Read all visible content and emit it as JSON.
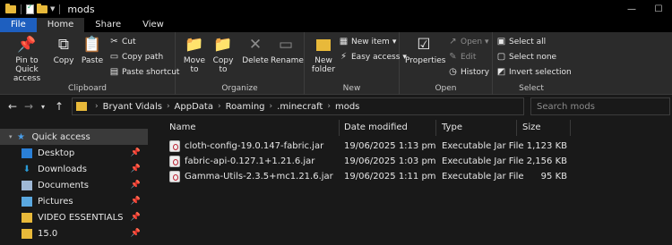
{
  "window": {
    "title": "mods"
  },
  "tabs": [
    "File",
    "Home",
    "Share",
    "View"
  ],
  "ribbon": {
    "clipboard": {
      "label": "Clipboard",
      "pin": "Pin to Quick access",
      "copy": "Copy",
      "paste": "Paste",
      "cut": "Cut",
      "copy_path": "Copy path",
      "paste_shortcut": "Paste shortcut"
    },
    "organize": {
      "label": "Organize",
      "move_to": "Move to",
      "copy_to": "Copy to",
      "delete": "Delete",
      "rename": "Rename"
    },
    "new": {
      "label": "New",
      "new_folder": "New folder",
      "new_item": "New item",
      "easy_access": "Easy access"
    },
    "open": {
      "label": "Open",
      "properties": "Properties",
      "open": "Open",
      "edit": "Edit",
      "history": "History"
    },
    "select": {
      "label": "Select",
      "select_all": "Select all",
      "select_none": "Select none",
      "invert": "Invert selection"
    }
  },
  "address": {
    "path": [
      "Bryant Vidals",
      "AppData",
      "Roaming",
      ".minecraft",
      "mods"
    ]
  },
  "search": {
    "placeholder": "Search mods"
  },
  "nav": [
    {
      "label": "Quick access",
      "icon": "star-icon",
      "pinned": false
    },
    {
      "label": "Desktop",
      "icon": "desktop-icon",
      "pinned": true
    },
    {
      "label": "Downloads",
      "icon": "download-icon",
      "pinned": true
    },
    {
      "label": "Documents",
      "icon": "documents-icon",
      "pinned": true
    },
    {
      "label": "Pictures",
      "icon": "pictures-icon",
      "pinned": true
    },
    {
      "label": "VIDEO ESSENTIALS",
      "icon": "folder-icon",
      "pinned": true
    },
    {
      "label": "15.0",
      "icon": "folder-icon",
      "pinned": true
    }
  ],
  "columns": {
    "name": "Name",
    "date": "Date modified",
    "type": "Type",
    "size": "Size"
  },
  "files": [
    {
      "name": "cloth-config-19.0.147-fabric.jar",
      "date": "19/06/2025 1:13 pm",
      "type": "Executable Jar File",
      "size": "1,123 KB"
    },
    {
      "name": "fabric-api-0.127.1+1.21.6.jar",
      "date": "19/06/2025 1:03 pm",
      "type": "Executable Jar File",
      "size": "2,156 KB"
    },
    {
      "name": "Gamma-Utils-2.3.5+mc1.21.6.jar",
      "date": "19/06/2025 1:11 pm",
      "type": "Executable Jar File",
      "size": "95 KB"
    }
  ]
}
